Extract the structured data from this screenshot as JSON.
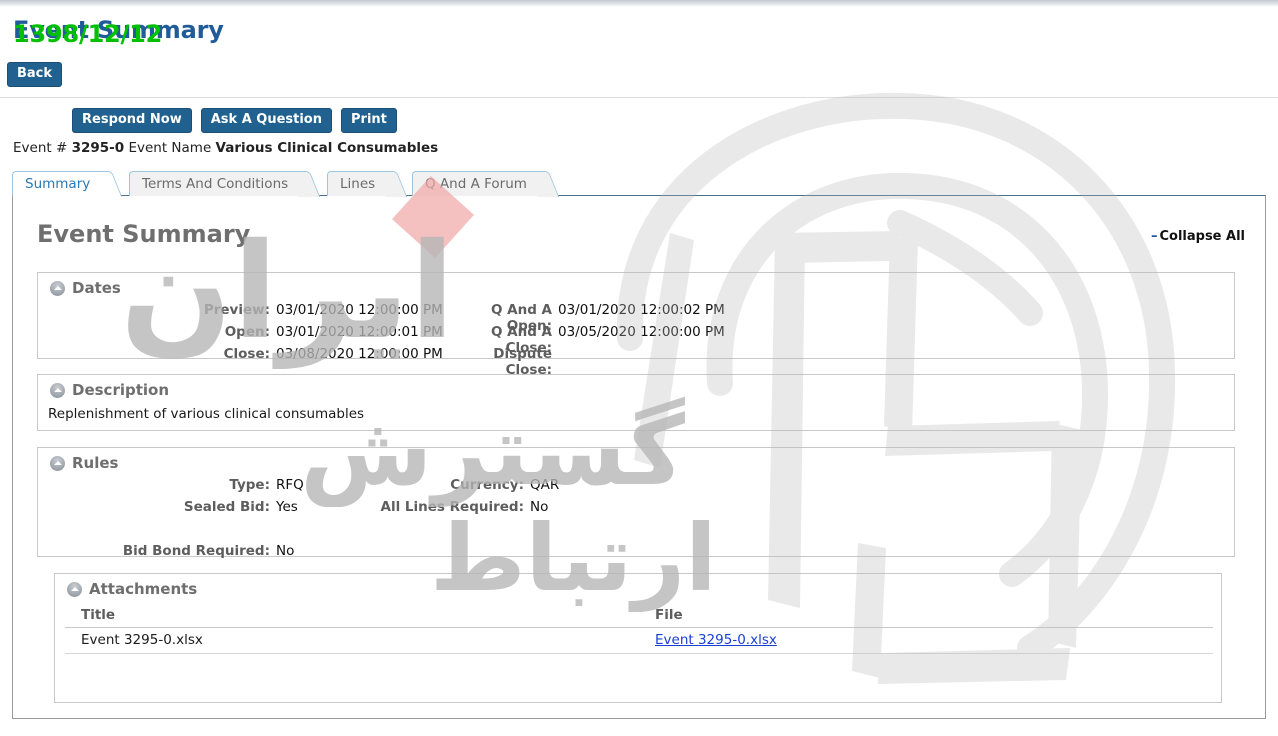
{
  "page": {
    "title": "Event Summary",
    "title_overlay": "1398/12/12",
    "back_label": "Back"
  },
  "toolbar": {
    "respond_label": "Respond Now",
    "ask_label": "Ask A Question",
    "print_label": "Print"
  },
  "event": {
    "number_label": "Event #",
    "number": "3295-0",
    "name_label": "Event Name",
    "name": "Various Clinical Consumables"
  },
  "tabs": [
    {
      "label": "Summary",
      "active": true
    },
    {
      "label": "Terms And Conditions",
      "active": false
    },
    {
      "label": "Lines",
      "active": false
    },
    {
      "label": "Q And A Forum",
      "active": false
    }
  ],
  "main": {
    "heading": "Event Summary",
    "collapse_all": "Collapse All",
    "collapse_all_sign": "–"
  },
  "sections": {
    "dates": {
      "title": "Dates",
      "left": [
        {
          "label": "Preview:",
          "value": "03/01/2020 12:00:00 PM"
        },
        {
          "label": "Open:",
          "value": "03/01/2020 12:00:01 PM"
        },
        {
          "label": "Close:",
          "value": "03/08/2020 12:00:00 PM"
        }
      ],
      "right": [
        {
          "label": "Q And A Open:",
          "value": "03/01/2020 12:00:02 PM"
        },
        {
          "label": "Q And A Close:",
          "value": "03/05/2020 12:00:00 PM"
        },
        {
          "label": "Dispute Close:",
          "value": ""
        }
      ]
    },
    "description": {
      "title": "Description",
      "text": "Replenishment of various clinical consumables"
    },
    "rules": {
      "title": "Rules",
      "left": [
        {
          "label": "Type:",
          "value": "RFQ"
        },
        {
          "label": "Sealed Bid:",
          "value": "Yes"
        },
        {
          "label": "",
          "value": ""
        },
        {
          "label": "Bid Bond Required:",
          "value": "No"
        }
      ],
      "right": [
        {
          "label": "Currency:",
          "value": "QAR"
        },
        {
          "label": "All Lines Required:",
          "value": "No"
        }
      ]
    },
    "attachments": {
      "title": "Attachments",
      "columns": [
        "Title",
        "File"
      ],
      "rows": [
        {
          "title": "Event 3295-0.xlsx",
          "file": "Event 3295-0.xlsx"
        }
      ]
    }
  },
  "watermark": {
    "line1": "ایران",
    "line2": "گسترش",
    "line3": "ارتباط"
  },
  "colors": {
    "title_blue": "#1f5c99",
    "overlay_green": "#00c000",
    "button_blue": "#21618f",
    "tab_active_text": "#2b78b5",
    "link_blue": "#1a3fd4",
    "watermark_gray": "#b6b6b6",
    "diamond_pink": "#f0a8a8"
  }
}
